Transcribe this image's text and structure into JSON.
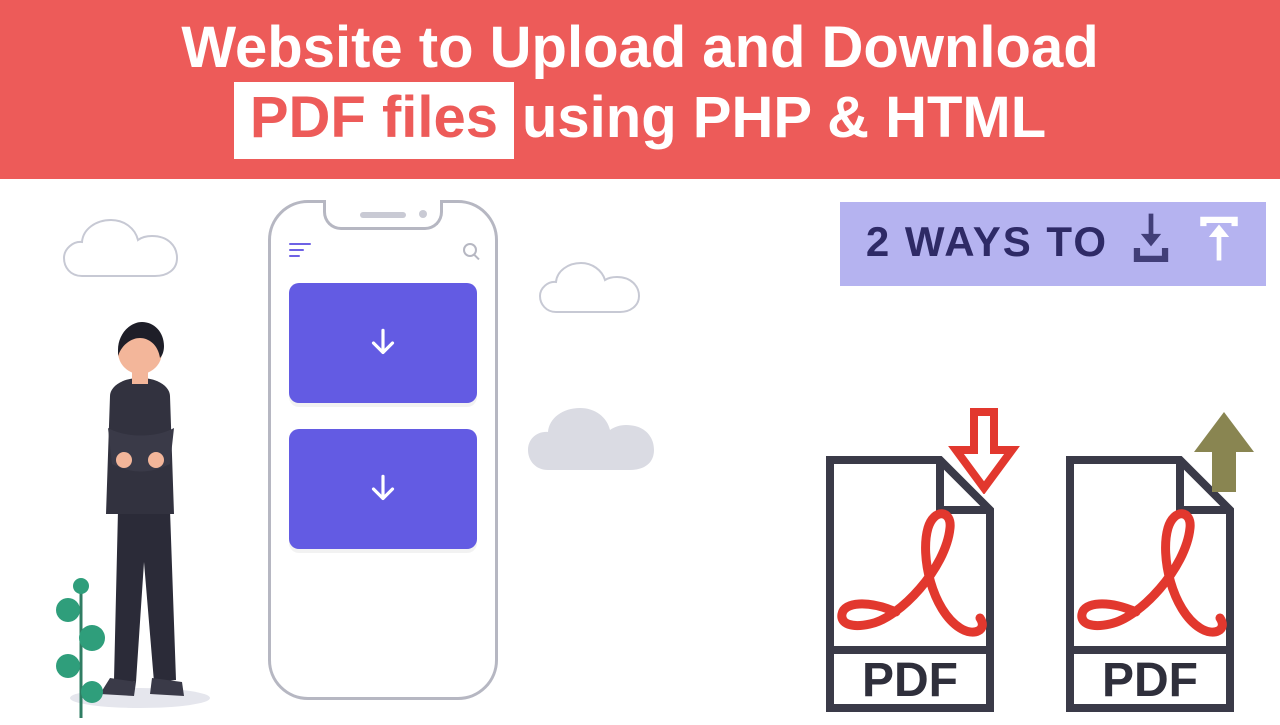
{
  "header": {
    "line1": "Website to Upload and Download",
    "pill": "PDF files",
    "line2_rest": "using PHP & HTML"
  },
  "badge": {
    "text": "2 WAYS TO"
  },
  "pdf": {
    "label": "PDF"
  },
  "colors": {
    "red": "#ED5B59",
    "lavender": "#B5B3F0",
    "violet": "#635BE3",
    "olive": "#898551"
  }
}
